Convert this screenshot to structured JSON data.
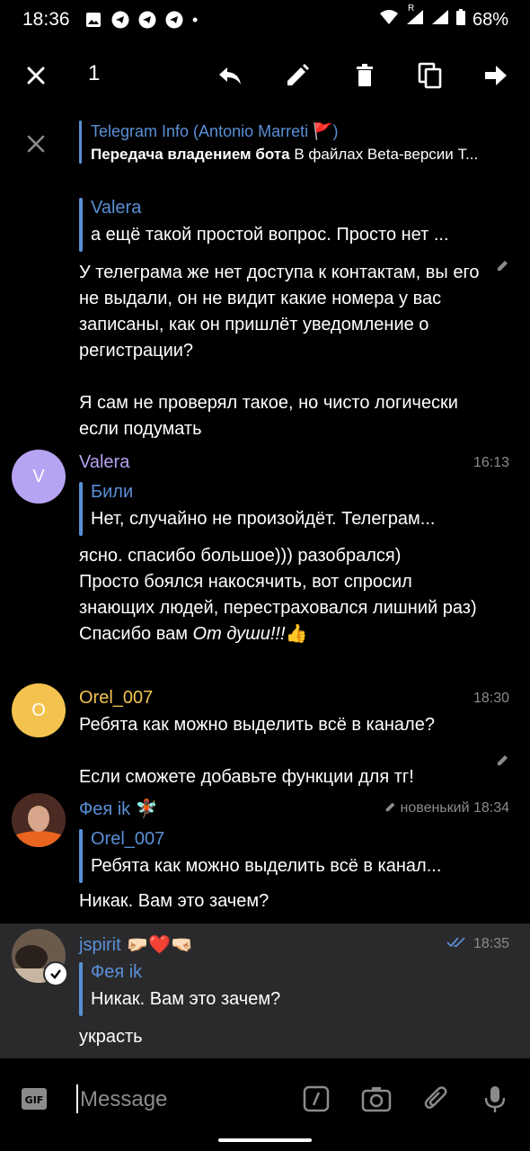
{
  "status_bar": {
    "time": "18:36",
    "battery": "68%",
    "network_badge": "R"
  },
  "toolbar": {
    "selected_count": "1",
    "icons": [
      "close-icon",
      "reply-icon",
      "edit-icon",
      "delete-icon",
      "copy-icon",
      "forward-icon"
    ]
  },
  "banner": {
    "title": "Telegram Info (Antonio Marreti 🚩)",
    "text_bold": "Передача владением бота",
    "text_rest": " В файлах Beta-версии T..."
  },
  "messages": [
    {
      "reply_name": "Valera",
      "reply_text": "а ещё такой простой вопрос. Просто нет ...",
      "body": "У телеграма же нет доступа к контактам, вы его не выдали, он не видит какие номера у вас записаны, как он пришлёт уведомление о регистрации?\n\nЯ сам не проверял такое, но чисто логически если подумать"
    },
    {
      "avatar_letter": "V",
      "avatar_color": "#b6a3f2",
      "sender": "Valera",
      "sender_color": "#b6a3f2",
      "time": "16:13",
      "reply_name": "Били",
      "reply_text": "Нет, случайно не произойдёт. Телеграм...",
      "body": "ясно. спасибо большое))) разобрался)\nПросто боялся накосячить, вот спросил знающих людей, перестраховался лишний раз)",
      "body_last_plain": "Спасибо вам ",
      "body_last_italic": "От души!!!",
      "body_last_emoji": "👍"
    },
    {
      "avatar_letter": "O",
      "avatar_color": "#f4c34f",
      "sender": "Orel_007",
      "sender_color": "#f4c34f",
      "time": "18:30",
      "body": "Ребята как можно выделить всё в канале?\n\nЕсли сможете добавьте функции для тг!"
    },
    {
      "sender": "Фея ik",
      "sender_emoji": "🧚🏿",
      "sender_color": "#5a8fd6",
      "time": "новенький 18:34",
      "reply_name": "Orel_007",
      "reply_text": "Ребята как можно выделить всё в канал...",
      "body": "Никак. Вам это зачем?"
    },
    {
      "sender": "jspirit",
      "sender_emoji": "🤛🏻❤️🤜🏻",
      "sender_color": "#5a8fd6",
      "time": "18:35",
      "reply_name": "Фея ik",
      "reply_text": "Никак. Вам это зачем?",
      "body": "украсть"
    }
  ],
  "composer": {
    "placeholder": "Message"
  },
  "colors": {
    "accent": "#5a8fd6",
    "selected_bg": "#2a2a2c",
    "time": "#8b8b8b"
  }
}
